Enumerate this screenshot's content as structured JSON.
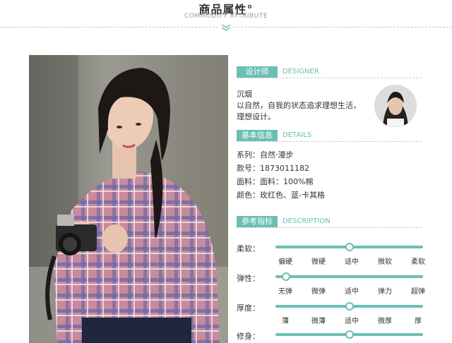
{
  "header": {
    "title": "商品属性°",
    "subtitle": "COMMODITY ATTRIBUTE"
  },
  "designer": {
    "tag": "设计师",
    "tag_en": "DESIGNER",
    "name": "沉烟",
    "line1": "以自然，自我的状态追求理想生活，",
    "line2": "理想设计。"
  },
  "details": {
    "tag": "基本信息",
    "tag_en": "DETAILS",
    "series": "系列：自然·漫步",
    "number": "款号：1873011182",
    "fabric": "面料：面料：100%棉",
    "color": "颜色：玫红色、蓝-卡其格"
  },
  "description": {
    "tag": "参考指标",
    "tag_en": "DESCRIPTION",
    "rows": [
      {
        "label": "柔软：",
        "options": [
          "偏硬",
          "微硬",
          "适中",
          "微软",
          "柔软"
        ],
        "selected_index": 2
      },
      {
        "label": "弹性：",
        "options": [
          "无弹",
          "微弹",
          "适中",
          "弹力",
          "超弹"
        ],
        "selected_index": 0
      },
      {
        "label": "厚度：",
        "options": [
          "薄",
          "微薄",
          "适中",
          "微厚",
          "厚"
        ],
        "selected_index": 2
      },
      {
        "label": "修身：",
        "options": [
          "",
          "",
          "",
          "",
          ""
        ],
        "selected_index": 2
      }
    ]
  },
  "colors": {
    "accent": "#6bbfb2"
  }
}
